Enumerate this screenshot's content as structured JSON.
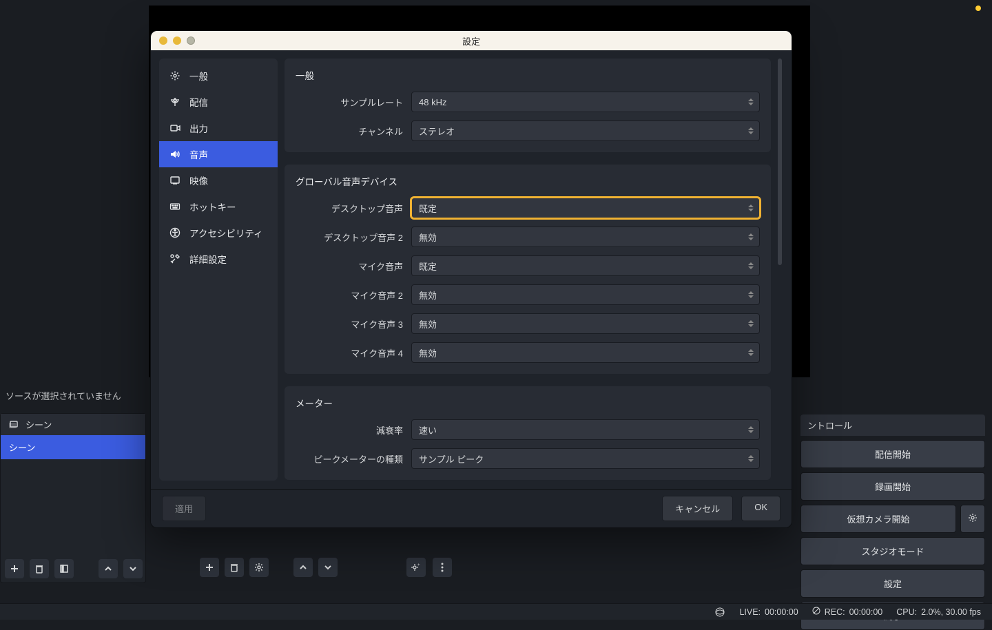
{
  "main": {
    "no_source_text": "ソースが選択されていません",
    "scenes": {
      "title": "シーン",
      "items": [
        "シーン"
      ]
    },
    "controls": {
      "title": "ントロール",
      "start_stream": "配信開始",
      "start_record": "録画開始",
      "start_vcam": "仮想カメラ開始",
      "studio_mode": "スタジオモード",
      "settings": "設定",
      "exit": "終了"
    }
  },
  "statusbar": {
    "live_label": "LIVE:",
    "live_time": "00:00:00",
    "rec_label": "REC:",
    "rec_time": "00:00:00",
    "cpu_label": "CPU:",
    "cpu_value": "2.0%, 30.00 fps"
  },
  "modal": {
    "title": "設定",
    "sidebar": {
      "general": "一般",
      "stream": "配信",
      "output": "出力",
      "audio": "音声",
      "video": "映像",
      "hotkeys": "ホットキー",
      "accessibility": "アクセシビリティ",
      "advanced": "詳細設定"
    },
    "sections": {
      "general": {
        "title": "一般",
        "sample_rate_label": "サンプルレート",
        "sample_rate_value": "48 kHz",
        "channels_label": "チャンネル",
        "channels_value": "ステレオ"
      },
      "global_audio": {
        "title": "グローバル音声デバイス",
        "desktop1_label": "デスクトップ音声",
        "desktop1_value": "既定",
        "desktop2_label": "デスクトップ音声 2",
        "desktop2_value": "無効",
        "mic1_label": "マイク音声",
        "mic1_value": "既定",
        "mic2_label": "マイク音声 2",
        "mic2_value": "無効",
        "mic3_label": "マイク音声 3",
        "mic3_value": "無効",
        "mic4_label": "マイク音声 4",
        "mic4_value": "無効"
      },
      "meters": {
        "title": "メーター",
        "decay_label": "減衰率",
        "decay_value": "速い",
        "peak_label": "ピークメーターの種類",
        "peak_value": "サンプル ピーク"
      }
    },
    "footer": {
      "apply": "適用",
      "cancel": "キャンセル",
      "ok": "OK"
    }
  }
}
